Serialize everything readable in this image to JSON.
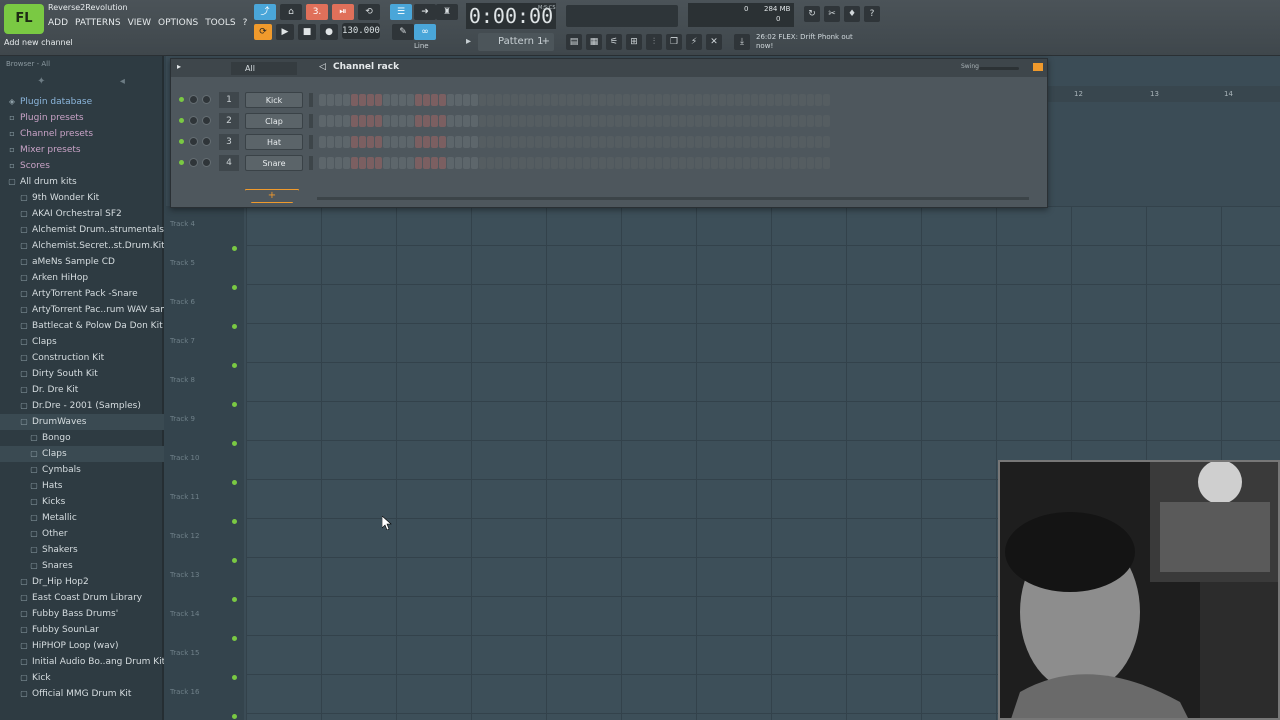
{
  "window": {
    "title": "Reverse2Revolution",
    "hint": "Add new channel",
    "logo": "FL"
  },
  "menu": [
    "ADD",
    "PATTERNS",
    "VIEW",
    "OPTIONS",
    "TOOLS",
    "?"
  ],
  "toolbar": {
    "time": "0:00:00",
    "time_label": "M:S:CS",
    "tempo": "130.000",
    "pattern": "Pattern 1",
    "line_mode": "Line",
    "ram": "284 MB",
    "cpu_value": "0",
    "poly_value": "0",
    "news_time": "26:02",
    "news_text": "FLEX: Drift Phonk out now!"
  },
  "browser": {
    "header": "Browser - All",
    "items": [
      {
        "label": "Plugin database",
        "kind": "cat"
      },
      {
        "label": "Plugin presets",
        "kind": "pink"
      },
      {
        "label": "Channel presets",
        "kind": "pink"
      },
      {
        "label": "Mixer presets",
        "kind": "pink"
      },
      {
        "label": "Scores",
        "kind": "pink"
      },
      {
        "label": "All drum kits",
        "kind": "blue"
      },
      {
        "label": "9th Wonder Kit",
        "kind": "fold"
      },
      {
        "label": "AKAI Orchestral SF2",
        "kind": "fold"
      },
      {
        "label": "Alchemist Drum..strumentals.com)",
        "kind": "fold"
      },
      {
        "label": "Alchemist.Secret..st.Drum.Kit).WAV",
        "kind": "fold"
      },
      {
        "label": "aMeNs Sample CD",
        "kind": "fold"
      },
      {
        "label": "Arken HiHop",
        "kind": "fold"
      },
      {
        "label": "ArtyTorrent Pack -Snare",
        "kind": "fold"
      },
      {
        "label": "ArtyTorrent Pac..rum WAV samples",
        "kind": "fold"
      },
      {
        "label": "Battlecat & Polow Da Don Kit",
        "kind": "fold"
      },
      {
        "label": "Claps",
        "kind": "fold"
      },
      {
        "label": "Construction Kit",
        "kind": "fold"
      },
      {
        "label": "Dirty South Kit",
        "kind": "fold"
      },
      {
        "label": "Dr. Dre Kit",
        "kind": "fold"
      },
      {
        "label": "Dr.Dre - 2001 (Samples)",
        "kind": "fold"
      },
      {
        "label": "DrumWaves",
        "kind": "open"
      },
      {
        "label": "Bongo",
        "kind": "sub"
      },
      {
        "label": "Claps",
        "kind": "subsel"
      },
      {
        "label": "Cymbals",
        "kind": "sub"
      },
      {
        "label": "Hats",
        "kind": "sub"
      },
      {
        "label": "Kicks",
        "kind": "sub"
      },
      {
        "label": "Metallic",
        "kind": "sub"
      },
      {
        "label": "Other",
        "kind": "sub"
      },
      {
        "label": "Shakers",
        "kind": "sub"
      },
      {
        "label": "Snares",
        "kind": "sub"
      },
      {
        "label": "Dr_Hip Hop2",
        "kind": "fold"
      },
      {
        "label": "East Coast Drum Library",
        "kind": "fold"
      },
      {
        "label": "Fubby  Bass Drums'",
        "kind": "fold"
      },
      {
        "label": "Fubby SounLar",
        "kind": "fold"
      },
      {
        "label": "HiPHOP Loop (wav)",
        "kind": "fold"
      },
      {
        "label": "Initial Audio Bo..ang Drum Kit WiN",
        "kind": "fold"
      },
      {
        "label": "Kick",
        "kind": "fold"
      },
      {
        "label": "Official MMG Drum Kit",
        "kind": "fold"
      }
    ]
  },
  "rack": {
    "title": "Channel rack",
    "filter": "All",
    "swing_label": "Swing",
    "add_label": "+",
    "channels": [
      {
        "num": "1",
        "name": "Kick"
      },
      {
        "num": "2",
        "name": "Clap"
      },
      {
        "num": "3",
        "name": "Hat"
      },
      {
        "num": "4",
        "name": "Snare"
      }
    ]
  },
  "playlist": {
    "ruler": [
      "12",
      "13",
      "14"
    ],
    "tracks": [
      "Track 4",
      "Track 5",
      "Track 6",
      "Track 7",
      "Track 8",
      "Track 9",
      "Track 10",
      "Track 11",
      "Track 12",
      "Track 13",
      "Track 14",
      "Track 15",
      "Track 16"
    ]
  }
}
